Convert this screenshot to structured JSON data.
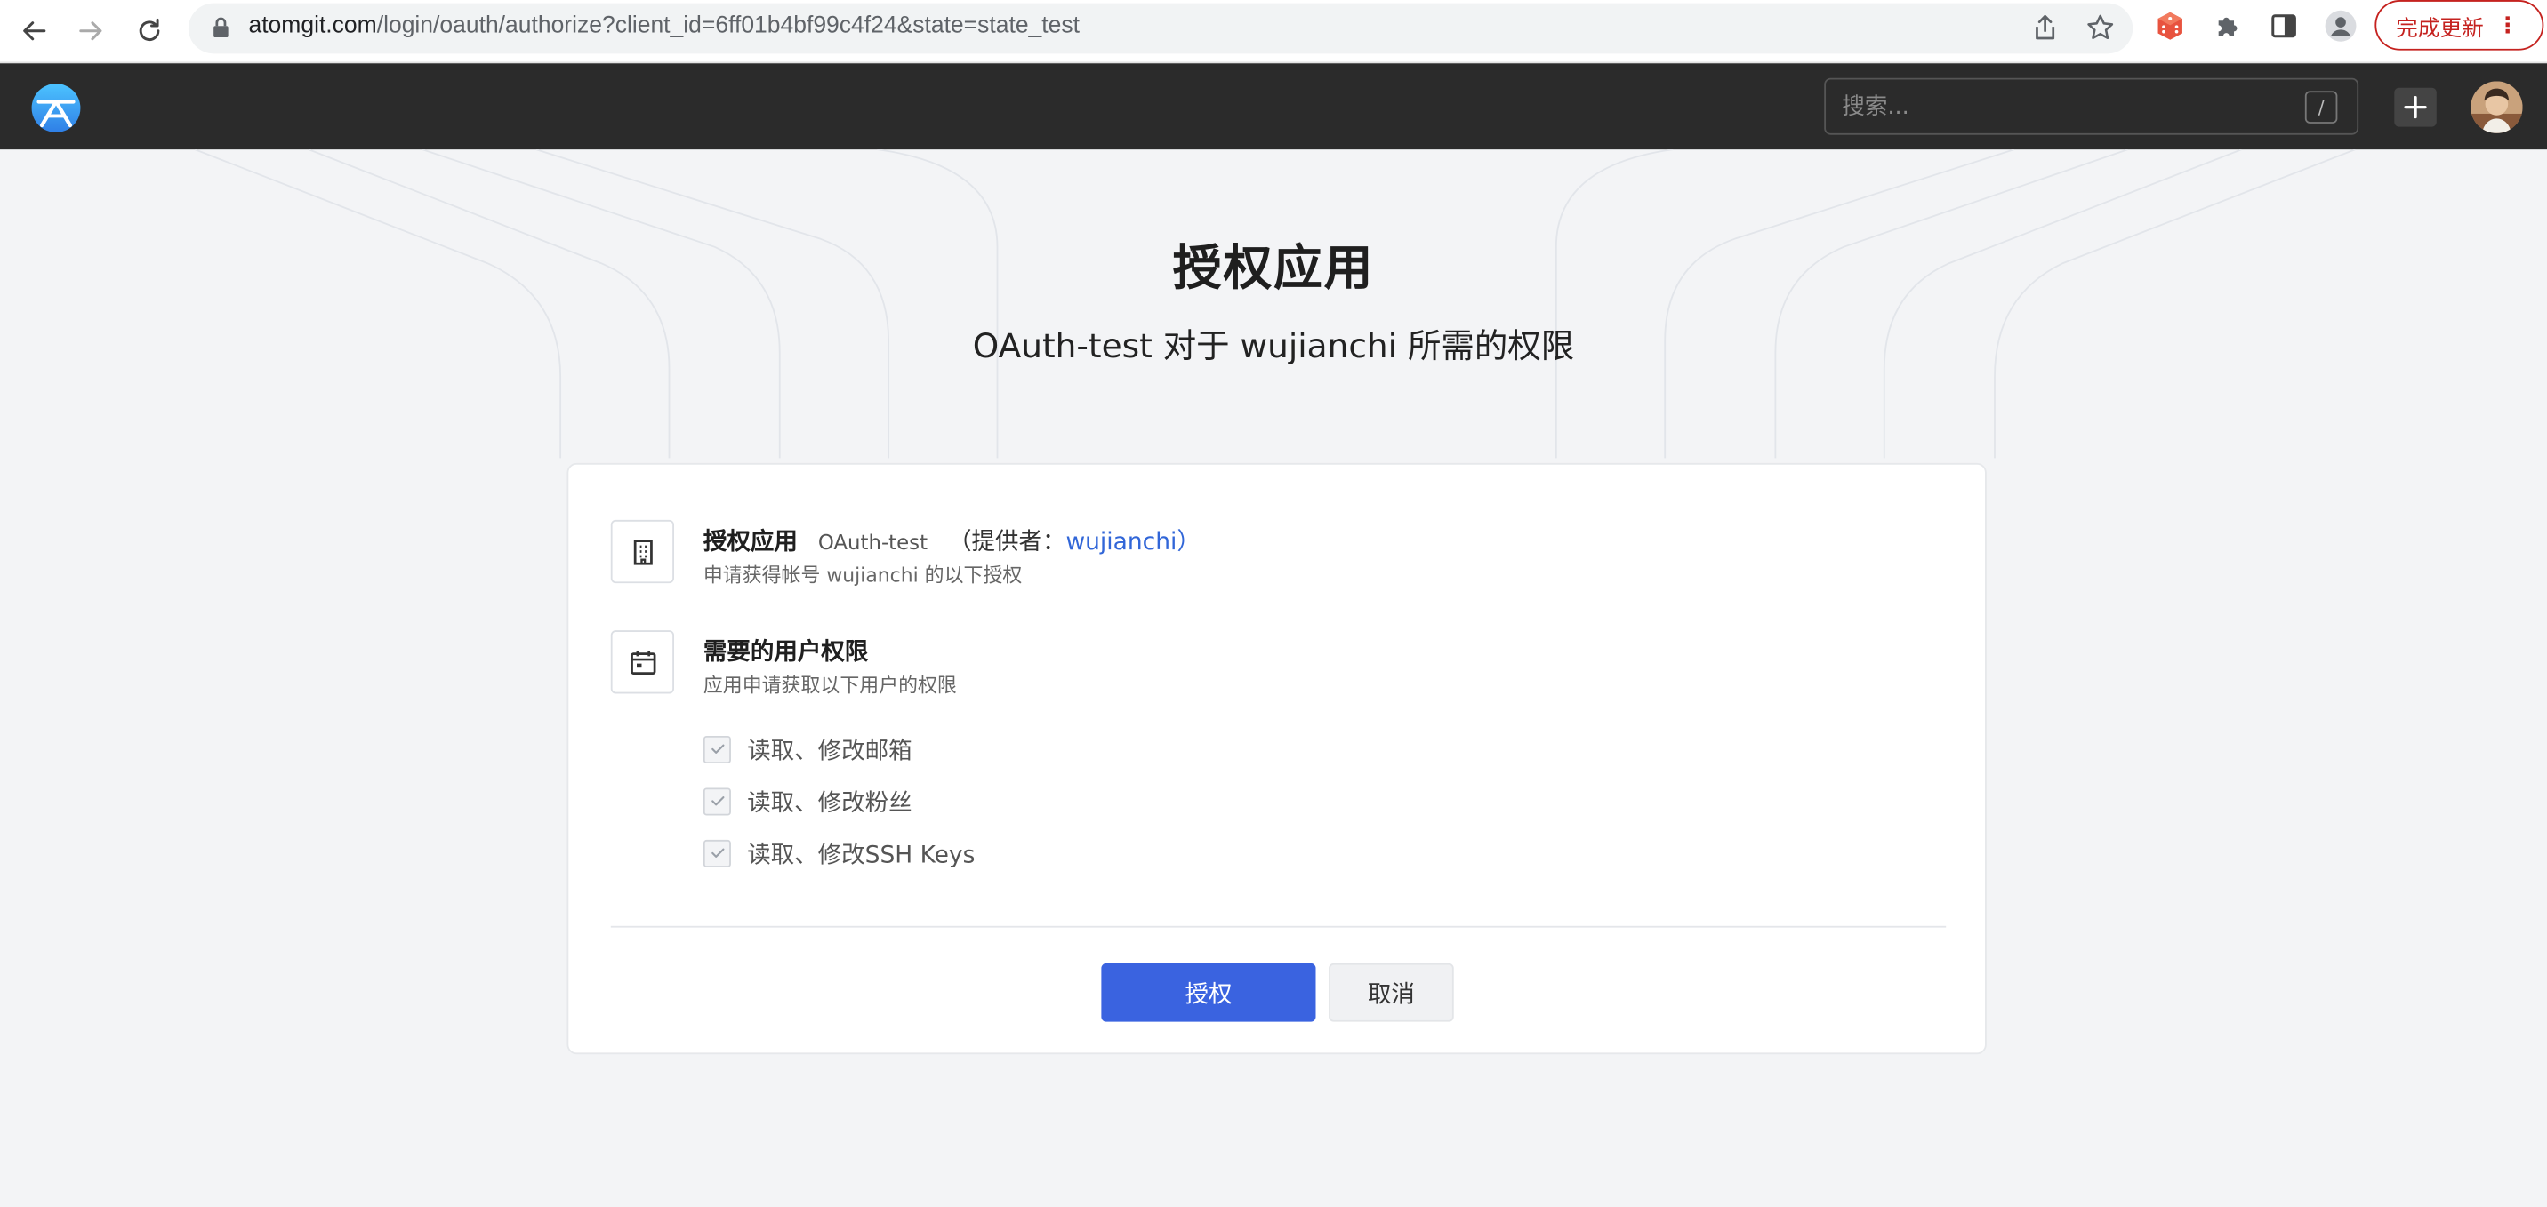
{
  "browser": {
    "url_host": "atomgit.com",
    "url_path": "/login/oauth/authorize?client_id=6ff01b4bf99c4f24&state=state_test",
    "update_button_label": "完成更新",
    "update_button_color": "#c5221f",
    "icons": [
      "back-icon",
      "forward-icon",
      "reload-icon",
      "lock-icon",
      "share-icon",
      "star-icon",
      "extension-dice-icon",
      "puzzle-icon",
      "sidepanel-icon",
      "profile-icon",
      "more-icon"
    ]
  },
  "header": {
    "search_placeholder": "搜索...",
    "search_shortcut": "/",
    "background": "#2b2b2b"
  },
  "page": {
    "title": "授权应用",
    "subtitle": "OAuth-test 对于 wujianchi 所需的权限"
  },
  "card": {
    "app_section": {
      "label": "授权应用",
      "app_name": "OAuth-test",
      "provider_prefix": "（提供者：",
      "provider_name": "wujianchi",
      "provider_suffix": "）",
      "description": "申请获得帐号  wujianchi  的以下授权"
    },
    "permissions_section": {
      "title": "需要的用户权限",
      "description": "应用申请获取以下用户的权限",
      "items": [
        {
          "label": "读取、修改邮箱",
          "checked": true
        },
        {
          "label": "读取、修改粉丝",
          "checked": true
        },
        {
          "label": "读取、修改SSH Keys",
          "checked": true
        }
      ]
    },
    "actions": {
      "authorize_label": "授权",
      "cancel_label": "取消",
      "primary_color": "#3a63e0"
    }
  }
}
